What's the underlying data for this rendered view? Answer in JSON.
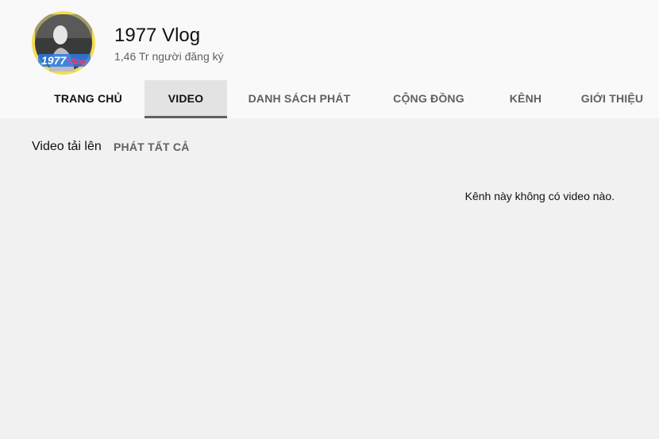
{
  "channel": {
    "name": "1977 Vlog",
    "subscribers": "1,46 Tr người đăng ký",
    "avatar_text": "1977 Vlog"
  },
  "tabs": [
    {
      "label": "TRANG CHỦ",
      "selected": false
    },
    {
      "label": "VIDEO",
      "selected": true
    },
    {
      "label": "DANH SÁCH PHÁT",
      "selected": false
    },
    {
      "label": "CỘNG ĐỒNG",
      "selected": false
    },
    {
      "label": "KÊNH",
      "selected": false
    },
    {
      "label": "GIỚI THIỆU",
      "selected": false
    }
  ],
  "uploads": {
    "title": "Video tải lên",
    "play_all_label": "PHÁT TẤT CẢ",
    "empty_message": "Kênh này không có video nào."
  },
  "colors": {
    "header_bg": "#f9f9f9",
    "page_bg": "#f1f1f1",
    "selected_tab_bg": "#e3e3e3",
    "avatar_ring": "#f3dc52"
  }
}
